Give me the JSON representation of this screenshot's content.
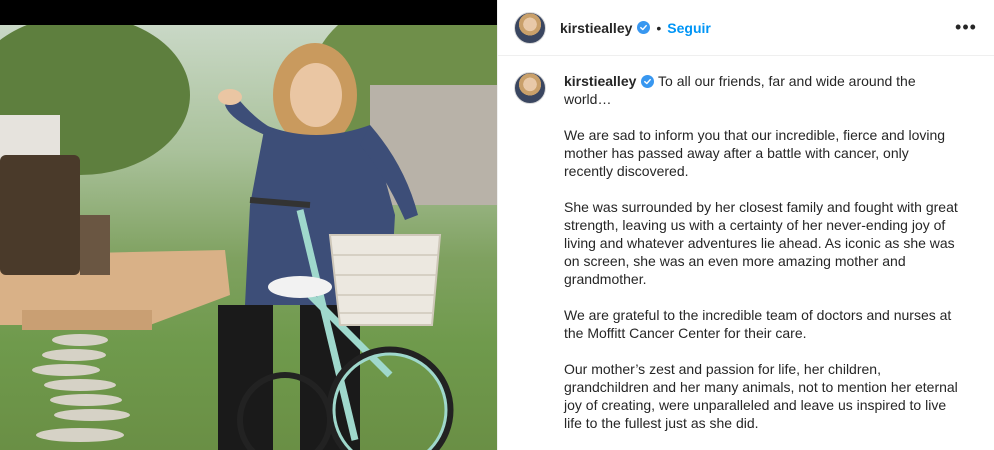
{
  "post": {
    "username": "kirstiealley",
    "dot": "•",
    "follow_label": "Seguir",
    "more_icon": "more-options-icon",
    "verified_icon": "verified-badge-icon",
    "photo": "post-photo",
    "caption": {
      "first_line": "To all our friends, far and wide around the world…",
      "paragraphs": [
        "We are sad to inform you that our incredible, fierce and loving mother has passed away after a battle with cancer, only recently discovered.",
        "She was surrounded by her closest family and fought with great strength, leaving us with a certainty of her never-ending joy of living and whatever adventures lie ahead. As iconic as she was on screen, she was an even more amazing mother and grandmother.",
        "We are grateful to the incredible team of doctors and nurses at the Moffitt Cancer Center for their care.",
        "Our mother’s zest and passion for life, her children, grandchildren and her many animals, not to mention her eternal joy of creating, were unparalleled and leave us inspired to live life to the fullest just as she did."
      ]
    }
  },
  "colors": {
    "accent": "#0095f6",
    "verified": "#3897f0",
    "text": "#262626"
  }
}
